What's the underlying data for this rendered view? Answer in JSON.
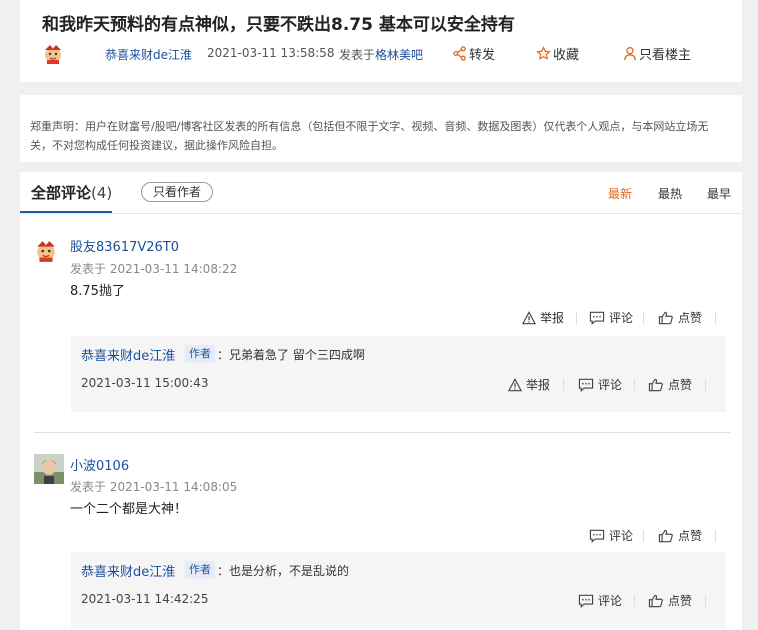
{
  "post": {
    "title": "和我昨天预料的有点神似，只要不跌出8.75 基本可以安全持有",
    "author": "恭喜来财de江淮",
    "time": "2021-03-11 13:58:58",
    "from_label": "发表于",
    "from_forum": "格林美吧",
    "actions": {
      "share": "转发",
      "favorite": "收藏",
      "only_owner": "只看楼主"
    }
  },
  "disclaimer": "郑重声明：用户在财富号/股吧/博客社区发表的所有信息（包括但不限于文字、视频、音频、数据及图表）仅代表个人观点，与本网站立场无关，不对您构成任何投资建议，据此操作风险自担。",
  "comments_section": {
    "tab_label": "全部评论",
    "count": "(4)",
    "only_author": "只看作者",
    "sort": [
      "最新",
      "最热",
      "最早"
    ],
    "sort_active": "最新"
  },
  "labels": {
    "report": "举报",
    "comment": "评论",
    "like": "点赞"
  },
  "comments": [
    {
      "user": "股友83617V26T0",
      "time": "发表于 2021-03-11 14:08:22",
      "text": "8.75抛了",
      "reply": {
        "user": "恭喜来财de江淮",
        "badge": "作者",
        "text": "：兄弟着急了 留个三四成啊",
        "time": "2021-03-11 15:00:43"
      }
    },
    {
      "user": "小波0106",
      "time": "发表于 2021-03-11 14:08:05",
      "text": "一个二个都是大神！",
      "reply": {
        "user": "恭喜来财de江淮",
        "badge": "作者",
        "text": "：也是分析，不是乱说的",
        "time": "2021-03-11 14:42:25"
      }
    }
  ],
  "colors": {
    "link": "#1c4e9c",
    "accent": "#e06a19",
    "tab_underline": "#1c5ba8"
  }
}
